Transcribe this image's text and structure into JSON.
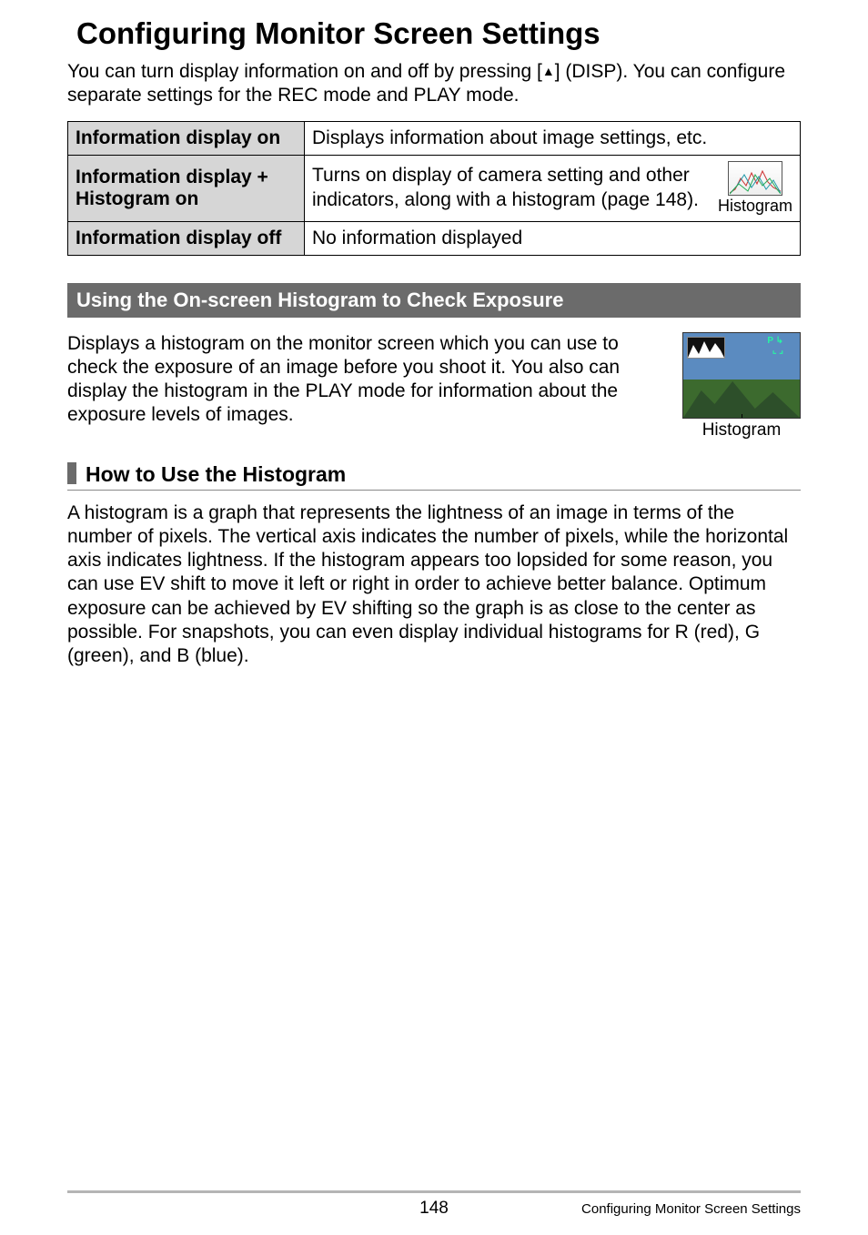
{
  "title": "Configuring Monitor Screen Settings",
  "intro_a": "You can turn display information on and off by pressing [",
  "intro_b": "] (DISP). You can configure separate settings for the REC mode and PLAY mode.",
  "up_glyph": "▲",
  "table": {
    "rows": [
      {
        "label": "Information display on",
        "desc": "Displays information about image settings, etc."
      },
      {
        "label": "Information display + Histogram on",
        "desc": "Turns on display of camera setting and other indicators, along with a histogram (page 148).",
        "thumb_label": "Histogram"
      },
      {
        "label": "Information display off",
        "desc": "No information displayed"
      }
    ]
  },
  "section1": {
    "heading": "Using the On-screen Histogram to Check Exposure",
    "body": "Displays a histogram on the monitor screen which you can use to check the exposure of an image before you shoot it. You also can display the histogram in the PLAY mode for information about the exposure levels of images.",
    "preview_label": "Histogram"
  },
  "section2": {
    "heading": "How to Use the Histogram",
    "body": "A histogram is a graph that represents the lightness of an image in terms of the number of pixels. The vertical axis indicates the number of pixels, while the horizontal axis indicates lightness. If the histogram appears too lopsided for some reason, you can use EV shift to move it left or right in order to achieve better balance. Optimum exposure can be achieved by EV shifting so the graph is as close to the center as possible. For snapshots, you can even display individual histograms for R (red), G (green), and B (blue)."
  },
  "footer": {
    "page_number": "148",
    "section_label": "Configuring Monitor Screen Settings"
  }
}
